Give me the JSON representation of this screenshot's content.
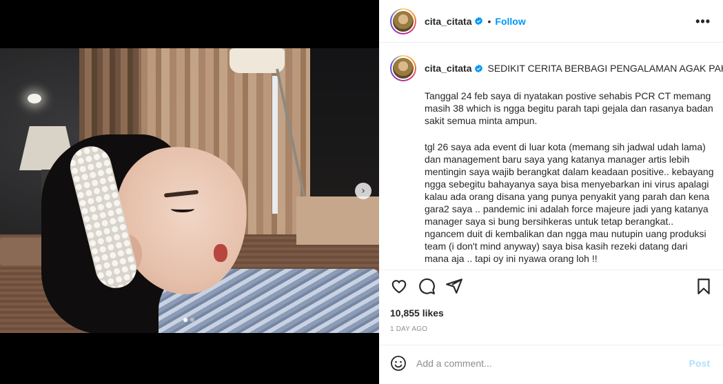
{
  "post": {
    "username": "cita_citata",
    "follow_label": "Follow",
    "more_label": "•••",
    "caption_title": "SEDIKIT CERITA BERBAGI PENGALAMAN AGAK PAHIT.",
    "caption_paragraphs": [
      "Tanggal 24 feb saya di nyatakan postive sehabis PCR CT memang masih 38 which is ngga begitu parah tapi gejala dan rasanya badan sakit semua minta ampun.",
      "tgl 26 saya ada event di luar kota (memang sih jadwal udah lama) dan management baru saya yang katanya manager artis lebih mentingin saya wajib berangkat dalam keadaan positive.. kebayang ngga sebegitu bahayanya saya bisa menyebarkan ini virus apalagi kalau ada orang disana yang punya penyakit yang parah dan kena gara2 saya .. pandemic ini adalah force majeure jadi yang katanya manager saya si bung bersihkeras untuk tetap berangkat.. ngancem duit di kembalikan dan ngga mau nutupin uang produksi team (i don't mind anyway) saya bisa kasih rezeki datang dari mana aja .. tapi oy ini nyawa orang loh !!"
    ],
    "likes": "10,855 likes",
    "time_ago": "1 DAY AGO",
    "comment_placeholder": "Add a comment...",
    "post_label": "Post",
    "carousel": {
      "slides": 2,
      "current": 1
    },
    "colors": {
      "link": "#0095f6",
      "post_disabled": "#b2dffc",
      "verified": "#0095f6"
    },
    "icons": [
      "heart-icon",
      "comment-icon",
      "share-icon",
      "bookmark-icon",
      "emoji-icon",
      "verified-icon",
      "chevron-right-icon"
    ]
  }
}
